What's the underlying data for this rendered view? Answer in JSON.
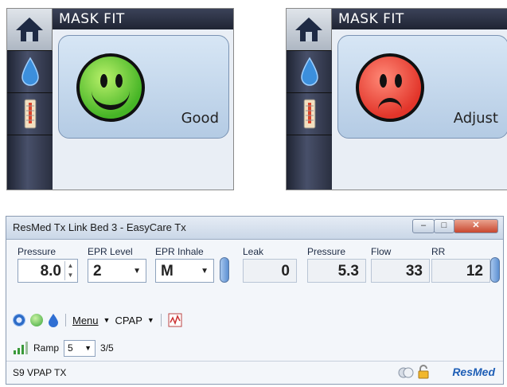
{
  "mask_fit_panels": [
    {
      "header": "MASK FIT",
      "status": "Good",
      "face": "smiley-icon",
      "color": "#46b526"
    },
    {
      "header": "MASK FIT",
      "status": "Adjust",
      "face": "frown-icon",
      "color": "#e2352a"
    }
  ],
  "window": {
    "title": "ResMed Tx Link Bed 3 - EasyCare Tx",
    "buttons": {
      "minimize": "–",
      "maximize": "□",
      "close": "✕"
    },
    "fields": {
      "pressure_set": {
        "label": "Pressure",
        "value": "8.0"
      },
      "epr_level": {
        "label": "EPR Level",
        "value": "2"
      },
      "epr_inhale": {
        "label": "EPR Inhale",
        "value": "M"
      },
      "leak": {
        "label": "Leak",
        "value": "0"
      },
      "pressure": {
        "label": "Pressure",
        "value": "5.3"
      },
      "flow": {
        "label": "Flow",
        "value": "33"
      },
      "rr": {
        "label": "RR",
        "value": "12"
      }
    },
    "toolbar": {
      "menu": "Menu",
      "mode": "CPAP"
    },
    "ramp": {
      "label": "Ramp",
      "value": "5",
      "progress": "3/5"
    },
    "status": {
      "model": "S9 VPAP TX",
      "brand": "ResMed"
    }
  },
  "colors": {
    "accent": "#1f5fb6"
  }
}
